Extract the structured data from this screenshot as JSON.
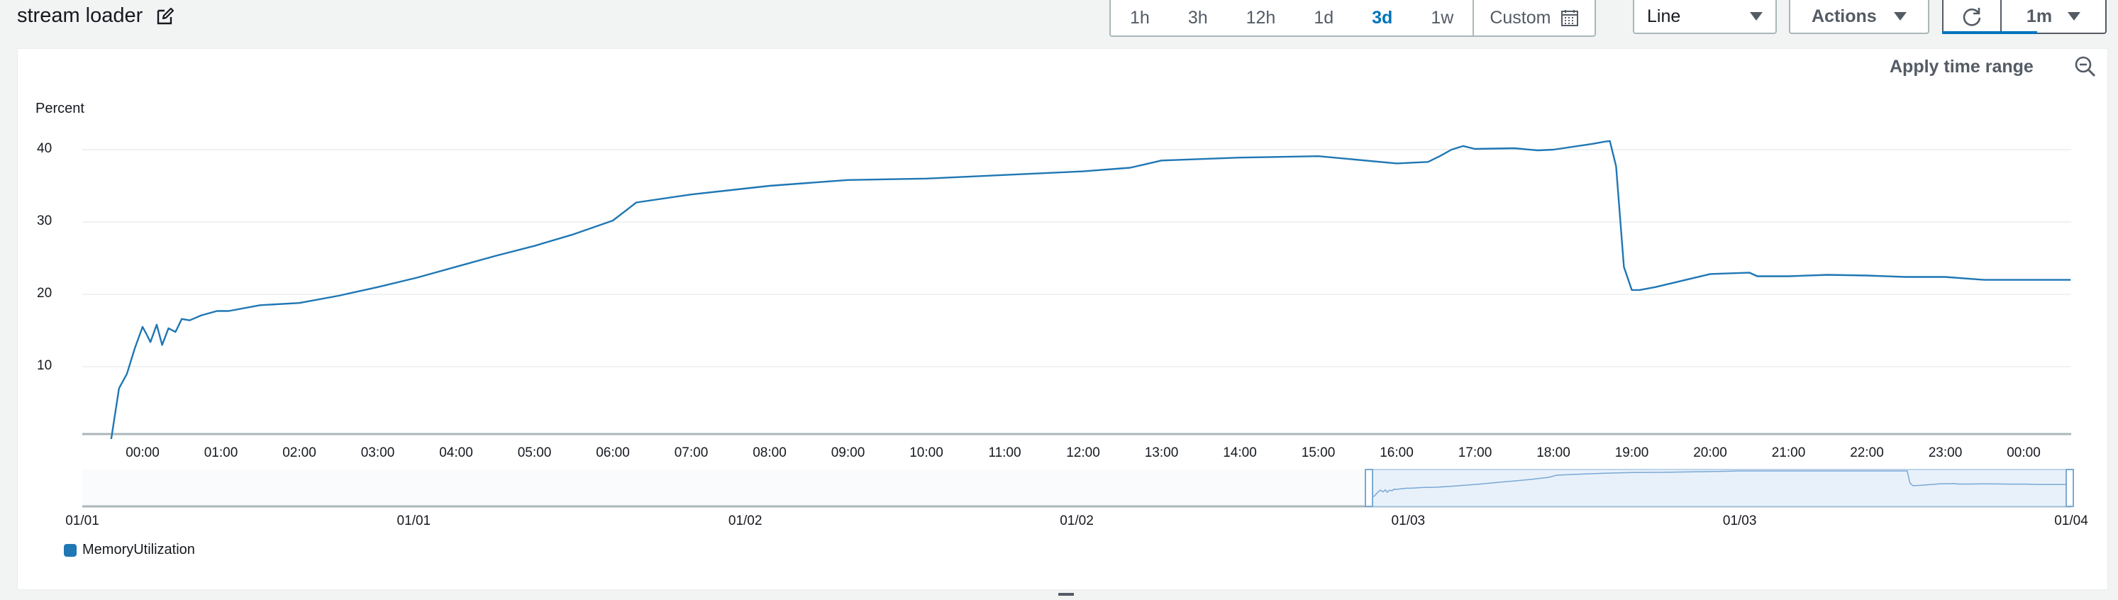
{
  "header": {
    "title": "stream loader",
    "time_ranges": [
      "1h",
      "3h",
      "12h",
      "1d",
      "3d",
      "1w"
    ],
    "active_range": "3d",
    "custom_label": "Custom",
    "view_type": "Line",
    "actions_label": "Actions",
    "refresh_interval": "1m"
  },
  "panel": {
    "apply_label": "Apply time range"
  },
  "colors": {
    "series": "#1f77b4",
    "accent": "#0073bb"
  },
  "chart_data": {
    "type": "line",
    "title": "",
    "ylabel": "Percent",
    "ylim": [
      0,
      45
    ],
    "yticks": [
      10,
      20,
      30,
      40
    ],
    "grid": true,
    "legend": "bottom-left",
    "x_ticks": [
      "00:00",
      "01:00",
      "02:00",
      "03:00",
      "04:00",
      "05:00",
      "06:00",
      "07:00",
      "08:00",
      "09:00",
      "10:00",
      "11:00",
      "12:00",
      "13:00",
      "14:00",
      "15:00",
      "16:00",
      "17:00",
      "18:00",
      "19:00",
      "20:00",
      "21:00",
      "22:00",
      "23:00",
      "00:00"
    ],
    "series": [
      {
        "name": "MemoryUtilization",
        "x": [
          -0.4,
          -0.3,
          -0.2,
          -0.1,
          0.0,
          0.05,
          0.1,
          0.18,
          0.25,
          0.33,
          0.42,
          0.5,
          0.6,
          0.75,
          0.95,
          1.1,
          1.5,
          2.0,
          2.5,
          3.0,
          3.5,
          4.0,
          4.5,
          5.0,
          5.5,
          6.0,
          6.3,
          7.0,
          8.0,
          9.0,
          10.0,
          11.0,
          12.0,
          12.6,
          12.8,
          13.0,
          14.0,
          15.0,
          16.0,
          16.4,
          16.55,
          16.7,
          16.85,
          17.0,
          17.5,
          17.8,
          18.0,
          18.5,
          18.65,
          18.72,
          18.8,
          18.9,
          19.0,
          19.1,
          19.3,
          20.0,
          20.5,
          20.6,
          21.0,
          21.5,
          22.0,
          22.5,
          22.6,
          23.0,
          23.5,
          24.0,
          24.6
        ],
        "values": [
          0.0,
          7.0,
          9.0,
          12.5,
          15.5,
          14.5,
          13.4,
          15.8,
          13.0,
          15.3,
          14.8,
          16.6,
          16.4,
          17.1,
          17.7,
          17.7,
          18.5,
          18.8,
          19.8,
          21.0,
          22.3,
          23.8,
          25.3,
          26.7,
          28.3,
          30.2,
          32.7,
          33.8,
          35.0,
          35.8,
          36.0,
          36.5,
          37.0,
          37.5,
          38.0,
          38.5,
          38.9,
          39.1,
          38.1,
          38.3,
          39.1,
          40.0,
          40.5,
          40.1,
          40.2,
          39.9,
          40.0,
          40.8,
          41.1,
          41.2,
          37.7,
          23.8,
          20.6,
          20.6,
          21.0,
          22.8,
          23.0,
          22.5,
          22.5,
          22.7,
          22.6,
          22.4,
          22.4,
          22.4,
          22.0,
          22.0,
          22.0
        ]
      }
    ],
    "navigator": {
      "date_ticks": [
        "01/01",
        "01/01",
        "01/02",
        "01/02",
        "01/03",
        "01/03",
        "01/04"
      ],
      "selection": "last day"
    }
  }
}
